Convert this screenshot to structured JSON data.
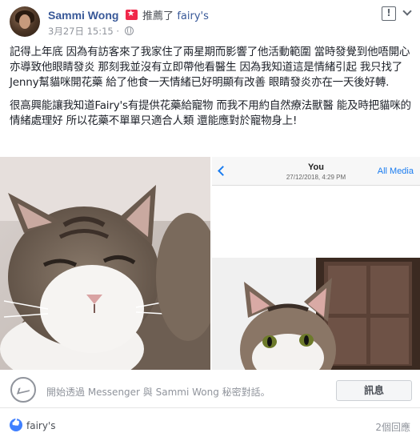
{
  "post": {
    "author": "Sammi Wong",
    "action": "推薦了",
    "page_name": "fairy's",
    "timestamp": "3月27日 15:15 ·",
    "paragraphs": [
      "記得上年底 因為有訪客來了我家住了兩星期而影響了他活動範圍 當時發覺到他唔開心 亦導致他眼睛發炎 那刻我並沒有立即帶他看醫生 因為我知道這是情緒引起 我只找了Jenny幫貓咪開花藥 給了他食一天情緒已好明顯有改善 眼睛發炎亦在一天後好轉.",
      "很高興能讓我知道Fairy's有提供花藥給寵物 而我不用約自然療法獸醫 能及時把貓咪的情緒處理好 所以花藥不單單只適合人類 還能應對於寵物身上!"
    ]
  },
  "screenshot": {
    "back_icon": "chevron-left-icon",
    "contact": "You",
    "datetime": "27/12/2018, 4:29 PM",
    "all_media": "All Media"
  },
  "messenger": {
    "prompt": "開始透過 Messenger 與 Sammi Wong 秘密對話。",
    "button": "訊息"
  },
  "footer": {
    "liker": "fairy's",
    "comments": "2個回應"
  },
  "colors": {
    "link": "#385898",
    "recommend": "#f0284a",
    "like": "#4080ff",
    "ios_blue": "#1a7cf0"
  }
}
